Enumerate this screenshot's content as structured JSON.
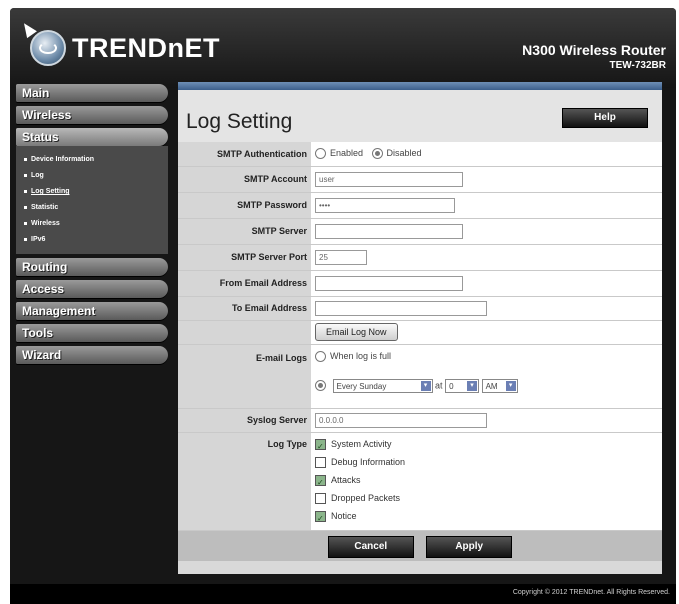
{
  "brand": {
    "logo_text": "TRENDnET",
    "product_name": "N300 Wireless Router",
    "model": "TEW-732BR"
  },
  "nav": {
    "items": [
      {
        "label": "Main"
      },
      {
        "label": "Wireless"
      },
      {
        "label": "Status"
      },
      {
        "label": "Routing"
      },
      {
        "label": "Access"
      },
      {
        "label": "Management"
      },
      {
        "label": "Tools"
      },
      {
        "label": "Wizard"
      }
    ],
    "status_sub": [
      {
        "label": "Device Information"
      },
      {
        "label": "Log"
      },
      {
        "label": "Log Setting"
      },
      {
        "label": "Statistic"
      },
      {
        "label": "Wireless"
      },
      {
        "label": "IPv6"
      }
    ]
  },
  "page": {
    "title": "Log Setting",
    "help_label": "Help"
  },
  "form": {
    "smtp_auth_label": "SMTP Authentication",
    "smtp_auth_enabled": "Enabled",
    "smtp_auth_disabled": "Disabled",
    "smtp_account_label": "SMTP Account",
    "smtp_account_value": "user",
    "smtp_password_label": "SMTP Password",
    "smtp_password_value": "••••",
    "smtp_server_label": "SMTP Server",
    "smtp_server_value": "",
    "smtp_port_label": "SMTP Server Port",
    "smtp_port_value": "25",
    "from_label": "From Email Address",
    "from_value": "",
    "to_label": "To Email Address",
    "to_value": "",
    "email_now_label": "Email Log Now",
    "email_logs_label": "E-mail Logs",
    "when_full_label": "When log is full",
    "schedule_day": "Every Sunday",
    "at_label": "at",
    "schedule_hour": "0",
    "schedule_ampm": "AM",
    "syslog_label": "Syslog Server",
    "syslog_value": "0.0.0.0",
    "logtype_label": "Log Type",
    "logtypes": [
      {
        "label": "System Activity",
        "checked": true
      },
      {
        "label": "Debug Information",
        "checked": false
      },
      {
        "label": "Attacks",
        "checked": true
      },
      {
        "label": "Dropped Packets",
        "checked": false
      },
      {
        "label": "Notice",
        "checked": true
      }
    ],
    "cancel_label": "Cancel",
    "apply_label": "Apply"
  },
  "footer": {
    "copyright": "Copyright © 2012 TRENDnet. All Rights Reserved."
  },
  "colors": {
    "header_bar": "#3c5f8c",
    "frame": "#161616",
    "select_arrow": "#6b7fb4"
  }
}
